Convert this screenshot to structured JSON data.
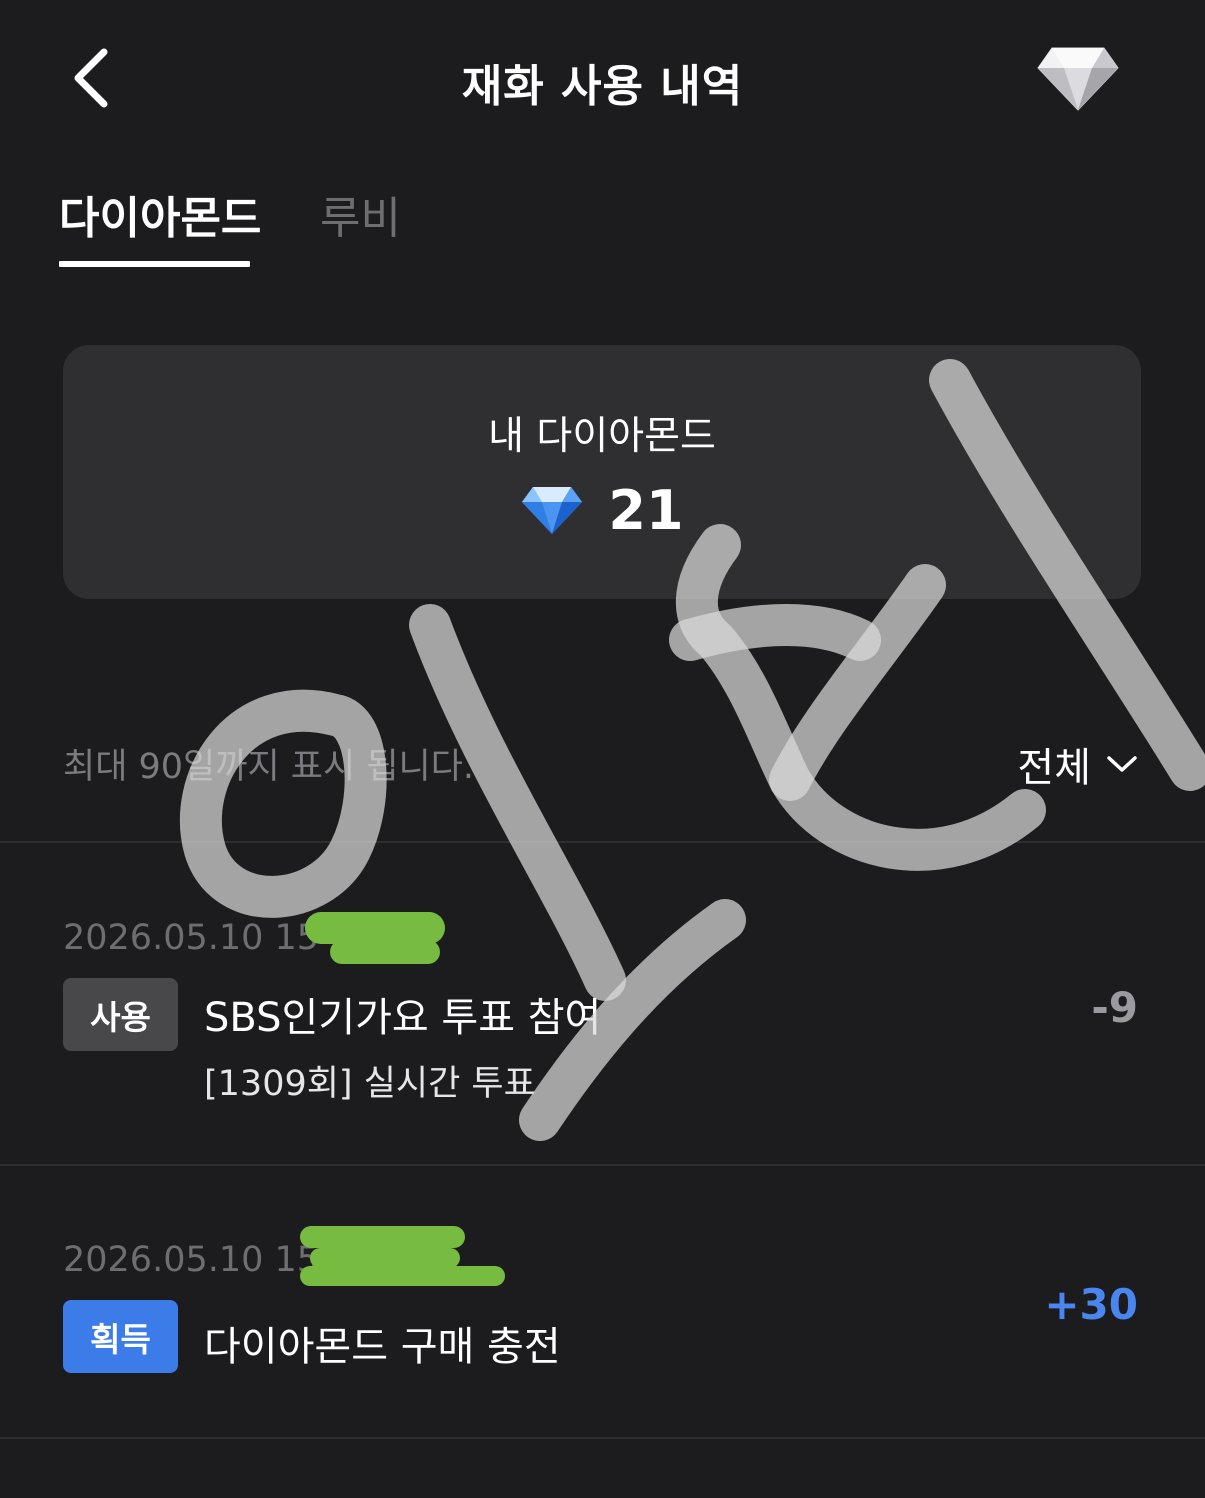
{
  "header": {
    "title": "재화 사용 내역"
  },
  "tabs": [
    {
      "label": "다이아몬드",
      "active": true
    },
    {
      "label": "루비",
      "active": false
    }
  ],
  "balance": {
    "label": "내 다이아몬드",
    "value": "21"
  },
  "filter": {
    "notice": "최대 90일까지 표시 됩니다.",
    "selected": "전체"
  },
  "history": [
    {
      "date": "2026.05.10 15",
      "badge": "사용",
      "title": "SBS인기가요 투표 참여",
      "subtitle": "[1309회] 실시간 투표",
      "amount": "-9"
    },
    {
      "date": "2026.05.10 15",
      "badge": "획득",
      "title": "다이아몬드 구매 충전",
      "amount": "+30"
    }
  ],
  "colors": {
    "background": "#1c1c1e",
    "card": "#2f2f32",
    "badge_use": "#48484b",
    "badge_gain": "#3b7ce8",
    "amount_positive": "#4a86f0",
    "amount_negative": "#9a9aa0",
    "redaction": "#77bb41"
  }
}
